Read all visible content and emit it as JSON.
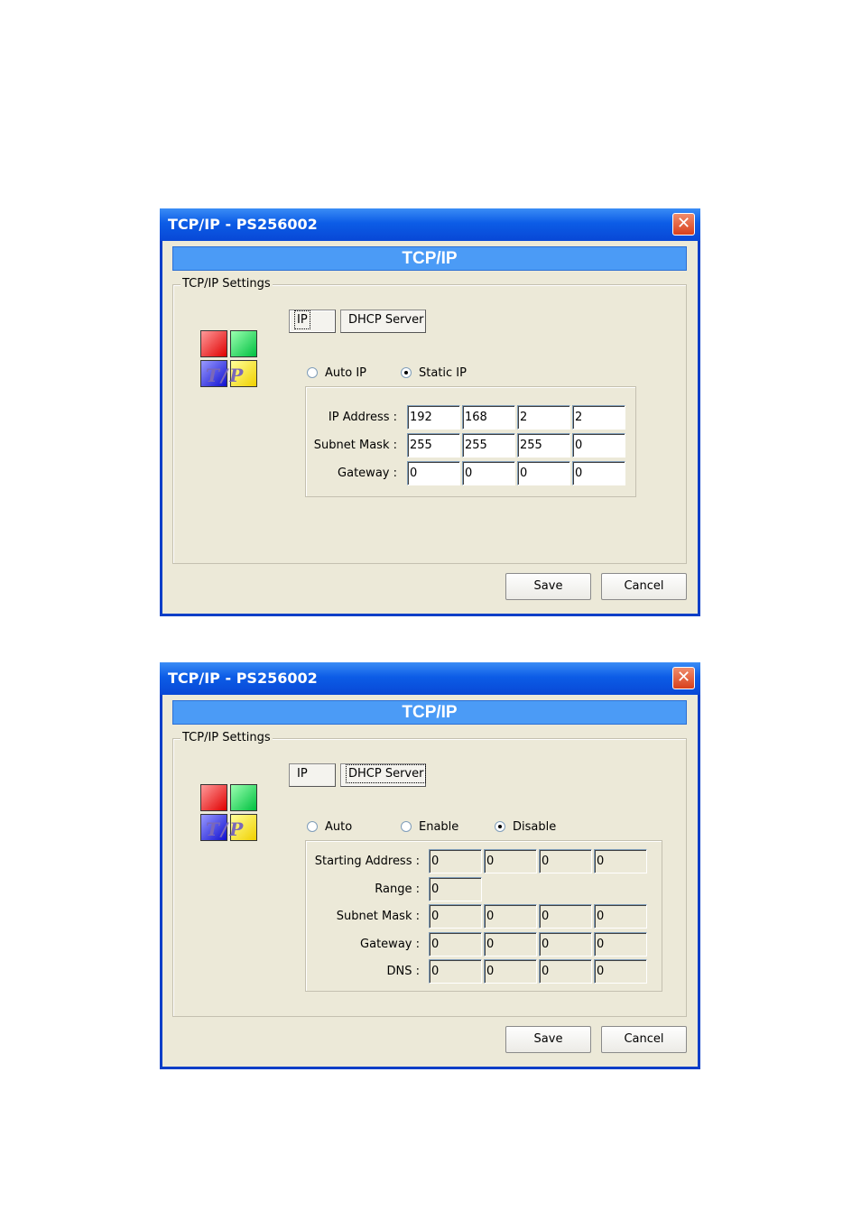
{
  "window1": {
    "title": "TCP/IP - PS256002",
    "close_glyph": "✕",
    "banner": "TCP/IP",
    "group_label": "TCP/IP Settings",
    "logo_text": "T/P",
    "tabs": {
      "ip": "IP",
      "dhcp": "DHCP Server",
      "active": "ip"
    },
    "radios": {
      "auto": "Auto IP",
      "static": "Static IP",
      "selected": "static"
    },
    "fields": {
      "ip_label": "IP Address :",
      "ip": [
        "192",
        "168",
        "2",
        "2"
      ],
      "mask_label": "Subnet Mask :",
      "mask": [
        "255",
        "255",
        "255",
        "0"
      ],
      "gw_label": "Gateway :",
      "gw": [
        "0",
        "0",
        "0",
        "0"
      ]
    },
    "save_label": "Save",
    "cancel_label": "Cancel"
  },
  "window2": {
    "title": "TCP/IP - PS256002",
    "close_glyph": "✕",
    "banner": "TCP/IP",
    "group_label": "TCP/IP Settings",
    "logo_text": "T/P",
    "tabs": {
      "ip": "IP",
      "dhcp": "DHCP Server",
      "active": "dhcp"
    },
    "radios": {
      "auto": "Auto",
      "enable": "Enable",
      "disable": "Disable",
      "selected": "disable"
    },
    "fields": {
      "start_label": "Starting Address :",
      "start": [
        "0",
        "0",
        "0",
        "0"
      ],
      "range_label": "Range :",
      "range": "0",
      "mask_label": "Subnet Mask :",
      "mask": [
        "0",
        "0",
        "0",
        "0"
      ],
      "gw_label": "Gateway :",
      "gw": [
        "0",
        "0",
        "0",
        "0"
      ],
      "dns_label": "DNS :",
      "dns": [
        "0",
        "0",
        "0",
        "0"
      ]
    },
    "save_label": "Save",
    "cancel_label": "Cancel"
  },
  "colors": {
    "title_bar": "#0c5ce6",
    "banner": "#4b9bf6",
    "face": "#ece9d8",
    "close": "#d8401c"
  },
  "icons": {
    "close": "close-icon",
    "logo": "tcpip-logo-icon"
  }
}
